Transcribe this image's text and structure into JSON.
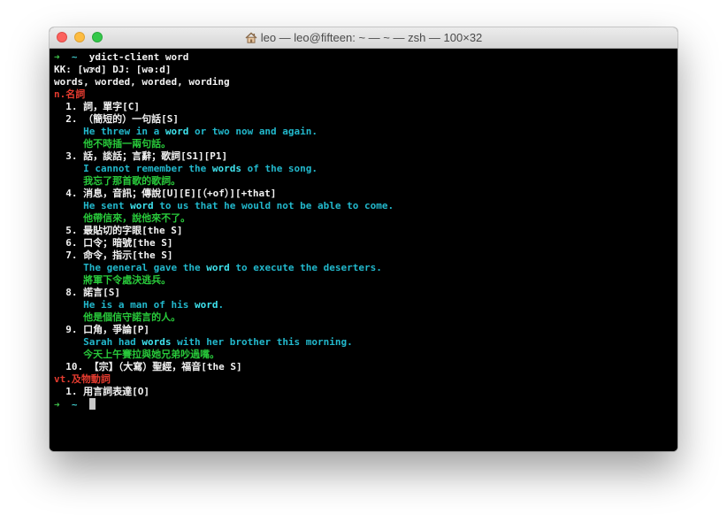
{
  "window": {
    "title": "leo — leo@fifteen: ~ — ~ — zsh — 100×32",
    "home_icon": "house-icon"
  },
  "colors": {
    "prompt_arrow": "#3ec24a",
    "prompt_tilde": "#3fc7c7",
    "part_of_speech": "#e43b2f",
    "example_en": "#22b8cc",
    "example_zh": "#28c93a",
    "highlight": "#3fe3ee"
  },
  "terminal": {
    "prompt": {
      "arrow": "➜",
      "dir": "~",
      "command": "ydict-client word"
    },
    "phonetic": "KK: [wɝd] DJ: [wə:d]",
    "forms": "words, worded, worded, wording",
    "pos_noun": "n.名詞",
    "senses": {
      "s1": {
        "num": "1.",
        "text": "詞，單字[C]"
      },
      "s2": {
        "num": "2.",
        "text": "（簡短的）一句話[S]",
        "en_pre": "He threw in a ",
        "en_hl": "word",
        "en_post": " or two now and again.",
        "zh": "他不時插一兩句話。"
      },
      "s3": {
        "num": "3.",
        "text": "話，談話；言辭；歌詞[S1][P1]",
        "en_pre": "I cannot remember the ",
        "en_hl": "words",
        "en_post": " of the song.",
        "zh": "我忘了那首歌的歌詞。"
      },
      "s4": {
        "num": "4.",
        "text": "消息，音訊；傳說[U][E][（+of）][+that]",
        "en_pre": "He sent ",
        "en_hl": "word",
        "en_post": " to us that he would not be able to come.",
        "zh": "他帶信來，說他來不了。"
      },
      "s5": {
        "num": "5.",
        "text": "最貼切的字眼[the S]"
      },
      "s6": {
        "num": "6.",
        "text": "口令；暗號[the S]"
      },
      "s7": {
        "num": "7.",
        "text": "命令，指示[the S]",
        "en_pre": "The general gave the ",
        "en_hl": "word",
        "en_post": " to execute the deserters.",
        "zh": "將軍下令處決逃兵。"
      },
      "s8": {
        "num": "8.",
        "text": "諾言[S]",
        "en_pre": "He is a man of his ",
        "en_hl": "word",
        "en_post": ".",
        "zh": "他是個信守諾言的人。"
      },
      "s9": {
        "num": "9.",
        "text": "口角，爭論[P]",
        "en_pre": "Sarah had ",
        "en_hl": "words",
        "en_post": " with her brother this morning.",
        "zh": "今天上午賽拉與她兄弟吵過嘴。"
      },
      "s10": {
        "num": "10.",
        "text": "【宗】（大寫）聖經，福音[the S]"
      }
    },
    "pos_verb": "vt.及物動詞",
    "verb_senses": {
      "v1": {
        "num": "1.",
        "text": "用言詞表達[O]"
      }
    },
    "end_prompt": {
      "arrow": "➜",
      "dir": "~"
    }
  }
}
